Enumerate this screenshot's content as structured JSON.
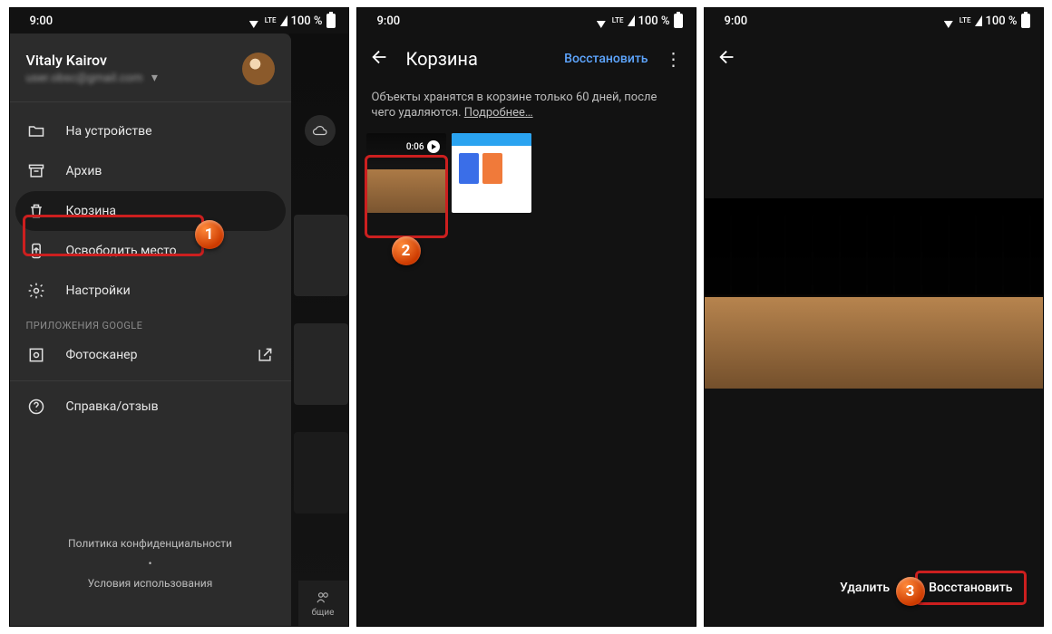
{
  "status": {
    "time": "9:00",
    "lte": "LTE",
    "battery": "100 %"
  },
  "screen1": {
    "user": {
      "name": "Vitaly Kairov",
      "email": "user.obsc@gmail.com"
    },
    "items": {
      "device": "На устройстве",
      "archive": "Архив",
      "trash": "Корзина",
      "free": "Освободить место",
      "settings": "Настройки"
    },
    "section_apps": "ПРИЛОЖЕНИЯ GOOGLE",
    "photoscan": "Фотосканер",
    "help": "Справка/отзыв",
    "footer": {
      "privacy": "Политика конфиденциальности",
      "dot": "•",
      "terms": "Условия использования"
    },
    "strip_label": "бщие"
  },
  "screen2": {
    "title": "Корзина",
    "restore": "Восстановить",
    "info": "Объекты хранятся в корзине только 60 дней, после чего удаляются.  ",
    "more": "Подробнее…",
    "video_len": "0:06"
  },
  "screen3": {
    "delete": "Удалить",
    "restore": "Восстановить"
  },
  "callouts": {
    "c1": "1",
    "c2": "2",
    "c3": "3"
  }
}
